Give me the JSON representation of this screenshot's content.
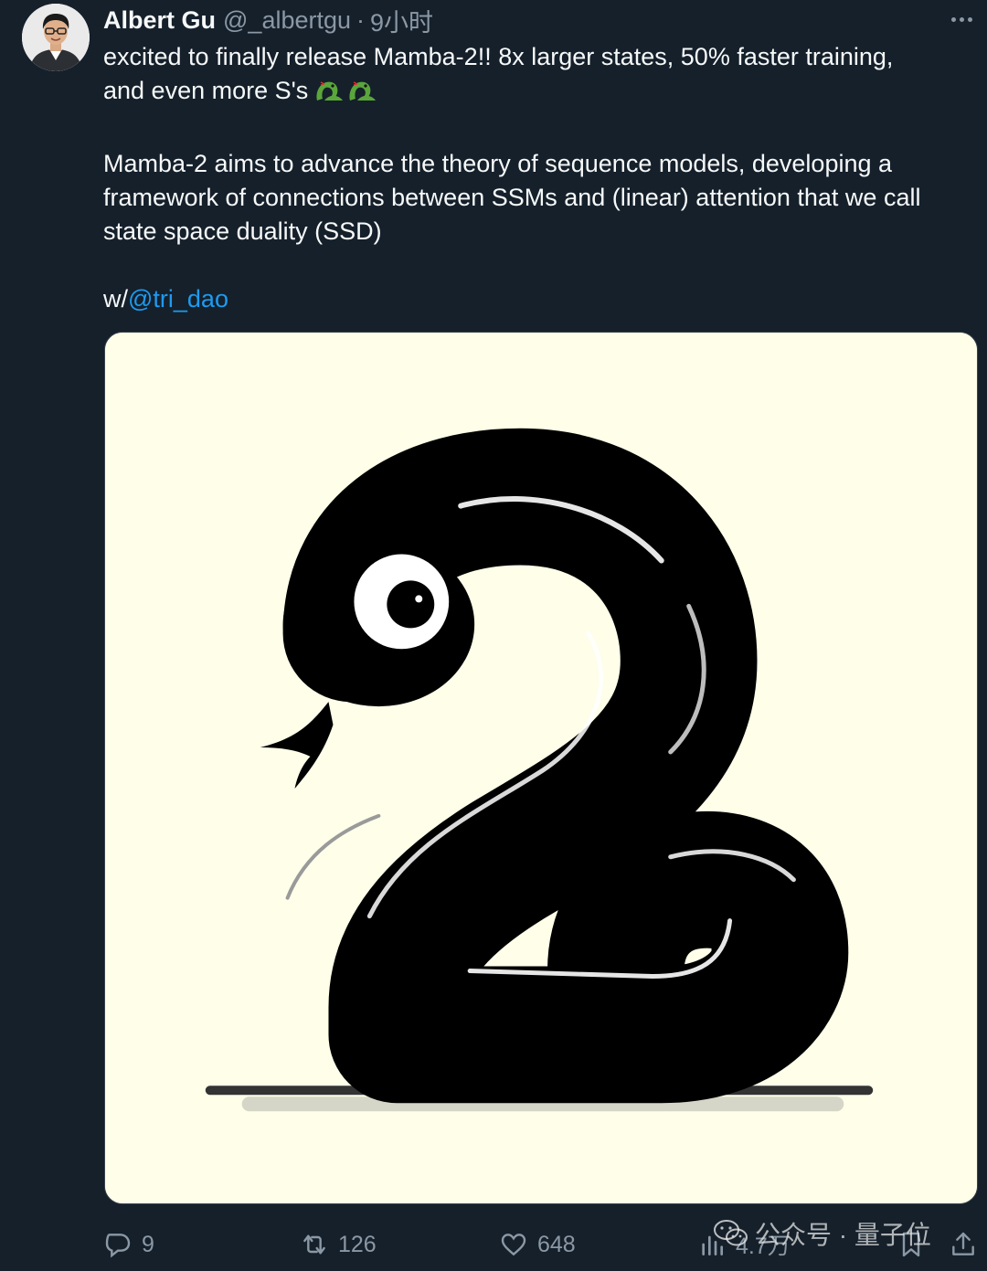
{
  "author": {
    "name": "Albert Gu",
    "handle": "@_albertgu",
    "separator": "·",
    "time": "9小时"
  },
  "tweet": {
    "line1": "excited to finally release Mamba-2!! 8x larger states, 50% faster training,",
    "line2": "and even more S's",
    "emoji": "🐍🐍",
    "para2": "Mamba-2 aims to advance the theory of sequence models, developing a framework of connections between SSMs and (linear) attention that we call state space duality (SSD)",
    "with_prefix": "w/",
    "mention": "@tri_dao"
  },
  "media": {
    "description_icon": "snake-shaped-number-2",
    "background_color": "#fefee9"
  },
  "actions": {
    "replies": "9",
    "retweets": "126",
    "likes": "648",
    "views": "4.7万"
  },
  "watermark": {
    "icon": "wechat-icon",
    "text": "公众号 · 量子位"
  },
  "colors": {
    "background": "#15202b",
    "text": "#f7f9f9",
    "muted": "#8b98a5",
    "accent": "#1d9bf0"
  }
}
